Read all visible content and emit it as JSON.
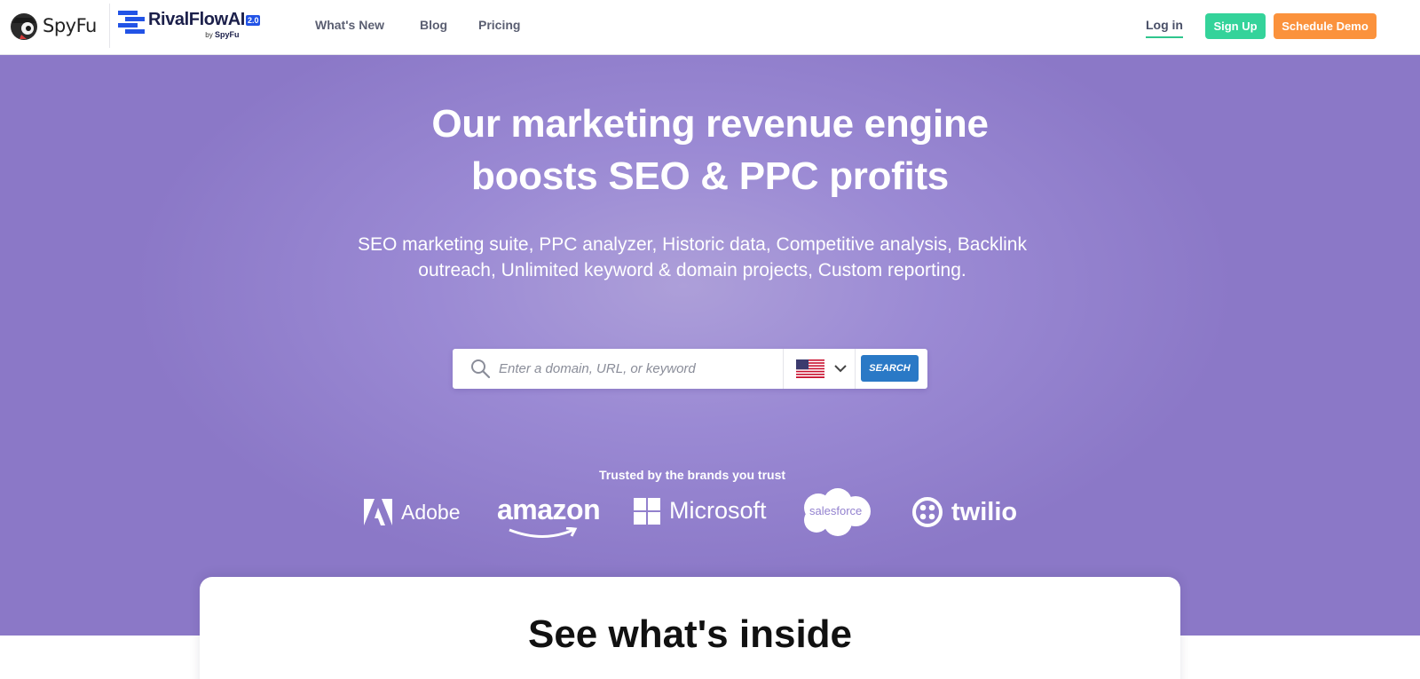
{
  "nav": {
    "spyfu_logo": "SpyFu",
    "rival_logo": {
      "name": "RivalFlowAI",
      "version": "2.0",
      "by_prefix": "by",
      "by_brand": "SpyFu"
    },
    "links": [
      "What's New",
      "Blog",
      "Pricing"
    ],
    "login": "Log in",
    "signup": "Sign Up",
    "schedule_demo": "Schedule Demo"
  },
  "hero": {
    "title_line1": "Our marketing revenue engine",
    "title_line2": "boosts SEO & PPC profits",
    "subtitle": "SEO marketing suite, PPC analyzer, Historic data, Competitive analysis, Backlink outreach, Unlimited keyword & domain projects, Custom reporting.",
    "search": {
      "placeholder": "Enter a domain, URL, or keyword",
      "country_icon": "us-flag-icon",
      "button": "SEARCH"
    },
    "trusted": "Trusted by the brands you trust",
    "brands": [
      "Adobe",
      "amazon",
      "Microsoft",
      "salesforce",
      "twilio"
    ]
  },
  "card": {
    "title": "See what's inside"
  },
  "colors": {
    "hero_bg": "#9b8ad4",
    "signup": "#34d39a",
    "demo": "#fb923c",
    "search_button": "#2a79c6",
    "login_underline": "#2fc58d"
  }
}
